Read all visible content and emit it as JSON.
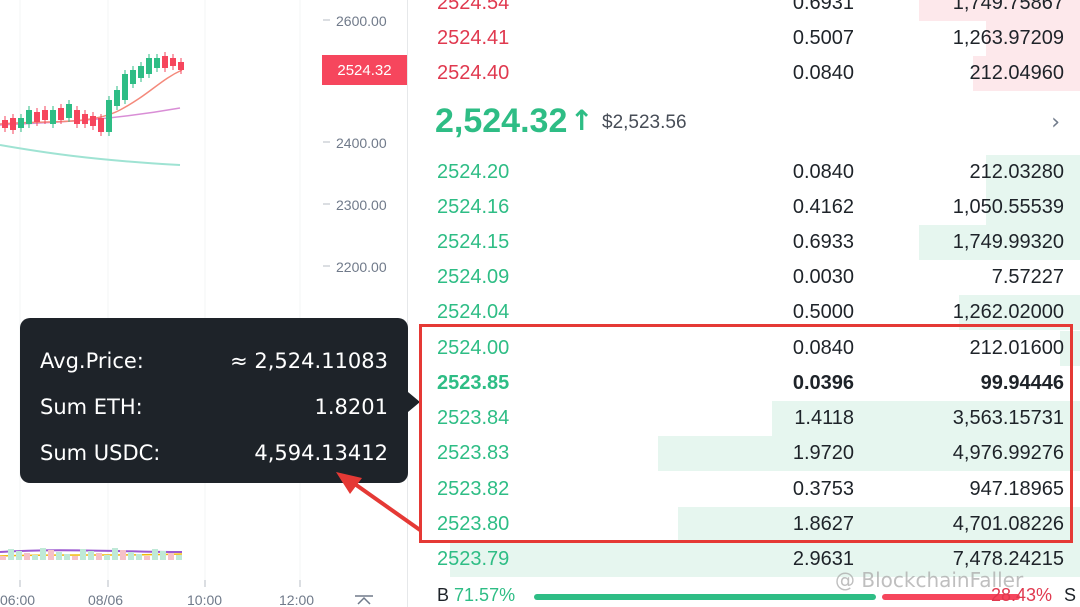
{
  "chart": {
    "y_axis_labels": [
      "2600.00",
      "2400.00",
      "2300.00",
      "2200.00"
    ],
    "x_axis_labels": [
      "06:00",
      "08/06",
      "10:00",
      "12:00"
    ],
    "current_price_tag": "2524.32",
    "colors": {
      "up": "#2ebd85",
      "down": "#f6465d",
      "ma_fast": "#f4897b",
      "ma_slow": "#d98ed6",
      "ma_long": "#9fe3d3"
    }
  },
  "tooltip": {
    "rows": [
      {
        "label": "Avg.Price:",
        "value": "≈ 2,524.11083"
      },
      {
        "label": "Sum ETH:",
        "value": "1.8201"
      },
      {
        "label": "Sum USDC:",
        "value": "4,594.13412"
      }
    ]
  },
  "orderbook": {
    "asks": [
      {
        "price": "2524.54",
        "amount": "0.6931",
        "total": "1,749.75867",
        "depth": 0.24
      },
      {
        "price": "2524.41",
        "amount": "0.5007",
        "total": "1,263.97209",
        "depth": 0.14
      },
      {
        "price": "2524.40",
        "amount": "0.0840",
        "total": "212.04960",
        "depth": 0.16
      }
    ],
    "mid": {
      "price": "2,524.32",
      "arrow": "↑",
      "usd": "$2,523.56",
      "chevron": "›"
    },
    "bids": [
      {
        "price": "2524.20",
        "amount": "0.0840",
        "total": "212.03280",
        "depth": 0.14,
        "bold": false
      },
      {
        "price": "2524.16",
        "amount": "0.4162",
        "total": "1,050.55539",
        "depth": 0.14,
        "bold": false
      },
      {
        "price": "2524.15",
        "amount": "0.6933",
        "total": "1,749.99320",
        "depth": 0.24,
        "bold": false
      },
      {
        "price": "2524.09",
        "amount": "0.0030",
        "total": "7.57227",
        "depth": 0.0,
        "bold": false
      },
      {
        "price": "2524.04",
        "amount": "0.5000",
        "total": "1,262.02000",
        "depth": 0.18,
        "bold": false
      },
      {
        "price": "2524.00",
        "amount": "0.0840",
        "total": "212.01600",
        "depth": 0.03,
        "bold": false
      },
      {
        "price": "2523.85",
        "amount": "0.0396",
        "total": "99.94446",
        "depth": 0.0,
        "bold": true
      },
      {
        "price": "2523.84",
        "amount": "1.4118",
        "total": "3,563.15731",
        "depth": 0.46,
        "bold": false
      },
      {
        "price": "2523.83",
        "amount": "1.9720",
        "total": "4,976.99276",
        "depth": 0.63,
        "bold": false
      },
      {
        "price": "2523.82",
        "amount": "0.3753",
        "total": "947.18965",
        "depth": 0.0,
        "bold": false
      },
      {
        "price": "2523.80",
        "amount": "1.8627",
        "total": "4,701.08226",
        "depth": 0.6,
        "bold": false
      },
      {
        "price": "2523.79",
        "amount": "2.9631",
        "total": "7,478.24215",
        "depth": 0.94,
        "bold": false
      }
    ],
    "ratio": {
      "buy_label": "B",
      "buy_pct": "71.57%",
      "sell_pct": "28.43%",
      "sell_label": "S",
      "buy_fraction": 0.7157
    }
  },
  "watermark": "@ BlockchainFaller"
}
